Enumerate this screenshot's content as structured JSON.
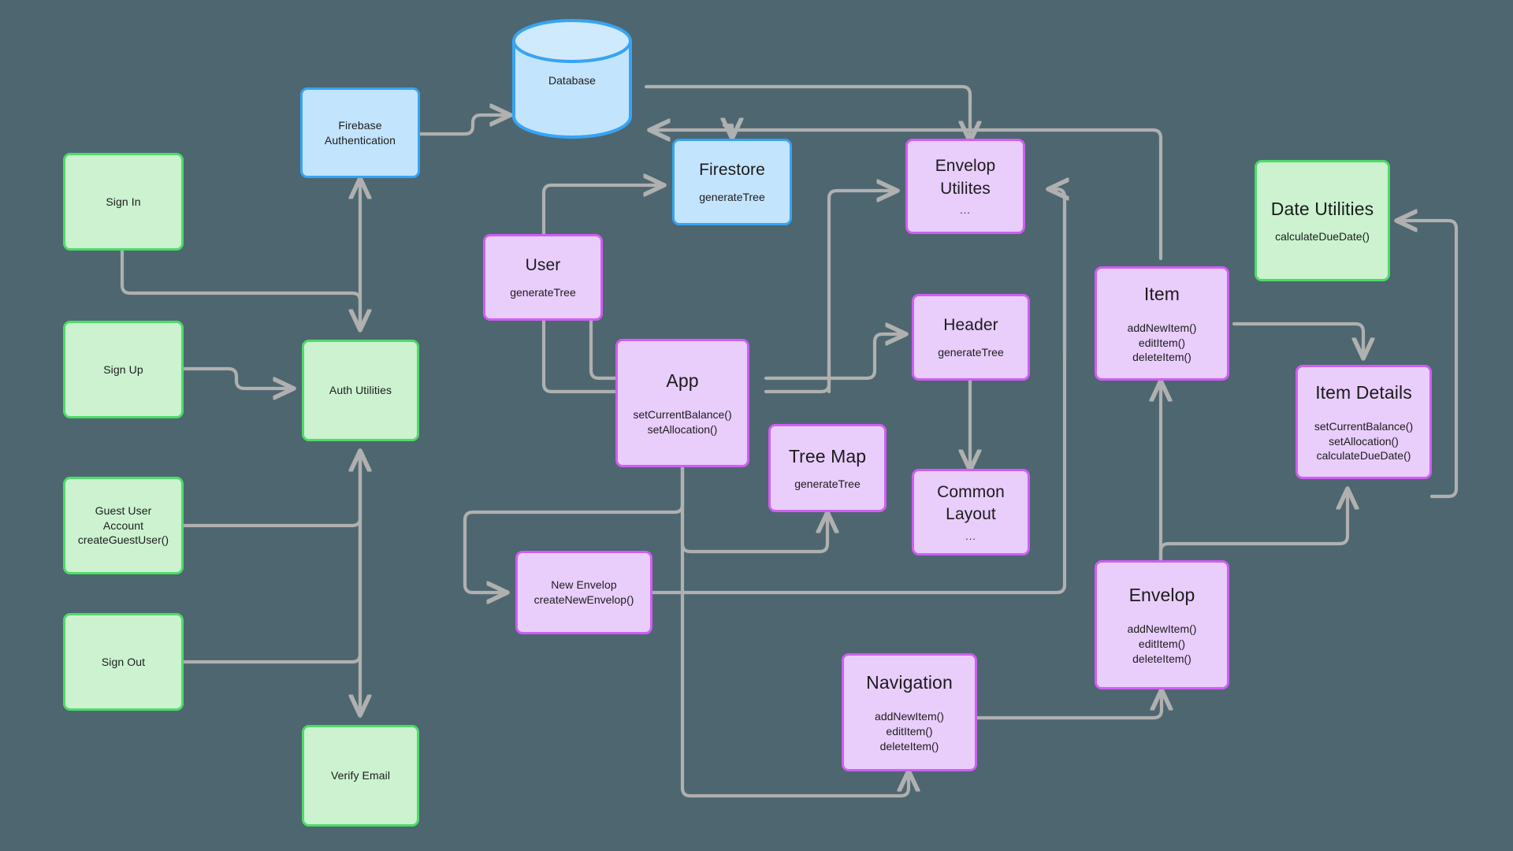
{
  "diagram": {
    "background_color": "#4e6670",
    "edge_color": "#b0b0b0",
    "palette": {
      "green_fill": "#ccf2d0",
      "green_stroke": "#4ddb67",
      "blue_fill": "#c3e4fd",
      "blue_stroke": "#36a4f4",
      "purple_fill": "#e9cdfb",
      "purple_stroke": "#cf5ef5"
    },
    "nodes": {
      "sign_in": {
        "title": "Sign In"
      },
      "sign_up": {
        "title": "Sign Up"
      },
      "guest_user_account": {
        "title": "Guest User",
        "title2": "Account",
        "method1": "createGuestUser()"
      },
      "sign_out": {
        "title": "Sign Out"
      },
      "auth_utilities": {
        "title": "Auth Utilities"
      },
      "verify_email": {
        "title": "Verify Email"
      },
      "firebase_authentication": {
        "title": "Firebase",
        "title2": "Authentication"
      },
      "database": {
        "title": "Database"
      },
      "firestore": {
        "title": "Firestore",
        "method1": "generateTree"
      },
      "user": {
        "title": "User",
        "method1": "generateTree"
      },
      "app": {
        "title": "App",
        "method1": "setCurrentBalance()",
        "method2": "setAllocation()"
      },
      "tree_map": {
        "title": "Tree Map",
        "method1": "generateTree"
      },
      "new_envelop": {
        "title": "New Envelop",
        "method1": "createNewEnvelop()"
      },
      "envelop_utilites": {
        "title": "Envelop",
        "title2": "Utilites",
        "dots": "..."
      },
      "header": {
        "title": "Header",
        "method1": "generateTree"
      },
      "common_layout": {
        "title": "Common",
        "title2": "Layout",
        "dots": "..."
      },
      "navigation": {
        "title": "Navigation",
        "method1": "addNewItem()",
        "method2": "editItem()",
        "method3": "deleteItem()"
      },
      "item": {
        "title": "Item",
        "method1": "addNewItem()",
        "method2": "editItem()",
        "method3": "deleteItem()"
      },
      "envelop": {
        "title": "Envelop",
        "method1": "addNewItem()",
        "method2": "editItem()",
        "method3": "deleteItem()"
      },
      "date_utilities": {
        "title": "Date Utilities",
        "method1": "calculateDueDate()"
      },
      "item_details": {
        "title": "Item Details",
        "method1": "setCurrentBalance()",
        "method2": "setAllocation()",
        "method3": "calculateDueDate()"
      }
    }
  }
}
